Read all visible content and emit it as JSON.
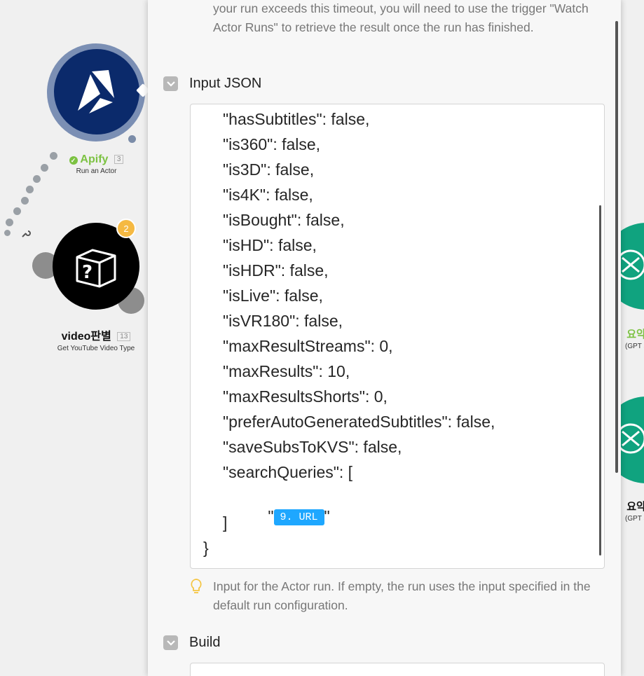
{
  "panel": {
    "timeout_help": "your run exceeds this timeout, you will need to use the trigger \"Watch Actor Runs\" to retrieve the result once the run has finished.",
    "input_json": {
      "label": "Input JSON",
      "lines": [
        "\"hasSubtitles\": false,",
        "\"is360\": false,",
        "\"is3D\": false,",
        "\"is4K\": false,",
        "\"isBought\": false,",
        "\"isHD\": false,",
        "\"isHDR\": false,",
        "\"isLive\": false,",
        "\"isVR180\": false,",
        "\"maxResultStreams\": 0,",
        "\"maxResults\": 10,",
        "\"maxResultsShorts\": 0,",
        "\"preferAutoGeneratedSubtitles\": false,",
        "\"saveSubsToKVS\": false,",
        "\"searchQueries\": ["
      ],
      "quote": "\"",
      "pill": "9. URL",
      "close_bracket": "]",
      "close_brace": "}",
      "hint": "Input for the Actor run. If empty, the run uses the input specified in the default run configuration."
    },
    "build": {
      "label": "Build"
    }
  },
  "canvas": {
    "nodes": [
      {
        "title": "Apify",
        "count": "3",
        "subtitle": "Run an Actor",
        "color": "#0b2a6b"
      },
      {
        "title": "video판별",
        "count": "13",
        "subtitle": "Get YouTube Video Type",
        "badge": "2",
        "color": "#000000"
      },
      {
        "title_fragment": "요약",
        "subtitle_fragment": "(GPT a",
        "color": "#10a37f"
      },
      {
        "title_fragment": "요약",
        "subtitle_fragment": "(GPT a",
        "color": "#10a37f"
      }
    ]
  },
  "colors": {
    "apify_green": "#7cc242",
    "pill_blue": "#1ea7ff",
    "badge_orange": "#f5b942",
    "openai_green": "#10a37f"
  }
}
